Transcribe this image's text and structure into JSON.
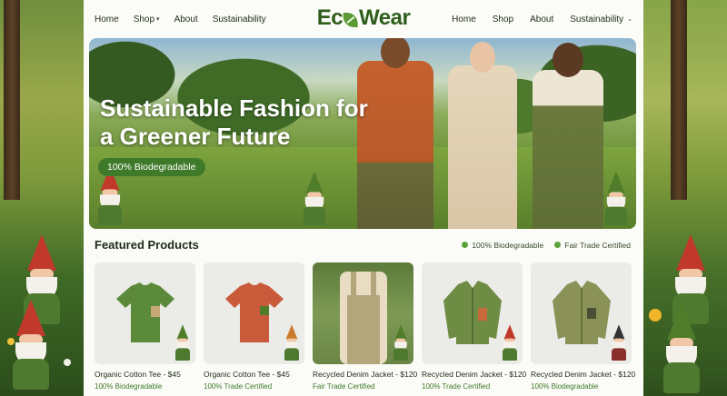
{
  "brand": {
    "logo_prefix": "Ec",
    "logo_suffix": "Wear"
  },
  "nav_left": [
    {
      "label": "Home"
    },
    {
      "label": "Shop"
    },
    {
      "label": "About"
    },
    {
      "label": "Sustainability"
    }
  ],
  "nav_right": [
    {
      "label": "Home"
    },
    {
      "label": "Shop"
    },
    {
      "label": "About"
    },
    {
      "label": "Sustainability"
    }
  ],
  "hero": {
    "title": "Sustainable Fashion for a Greener Future",
    "badge": "100% Biodegradable"
  },
  "featured": {
    "title": "Featured Products",
    "tags": [
      "100% Biodegradable",
      "Fair Trade Certified"
    ]
  },
  "products": [
    {
      "name": "Organic Cotton Tee - $45",
      "cert": "100% Biodegradable",
      "color": "#5b8a3a"
    },
    {
      "name": "Organic Cotton Tee - $45",
      "cert": "100% Trade Certified",
      "color": "#c95a3a"
    },
    {
      "name": "Recycled Denim Jacket - $120",
      "cert": "Fair Trade Certified",
      "color": "#a99a6e"
    },
    {
      "name": "Recycled Denim Jacket - $120",
      "cert": "100% Trade Certified",
      "color": "#6f8c45"
    },
    {
      "name": "Recycled Denim Jacket - $120",
      "cert": "100% Biodegradable",
      "color": "#8a9257"
    }
  ],
  "colors": {
    "accent": "#3f7a2a",
    "logo": "#2f5d1c",
    "page_bg": "#fbfcf7"
  }
}
